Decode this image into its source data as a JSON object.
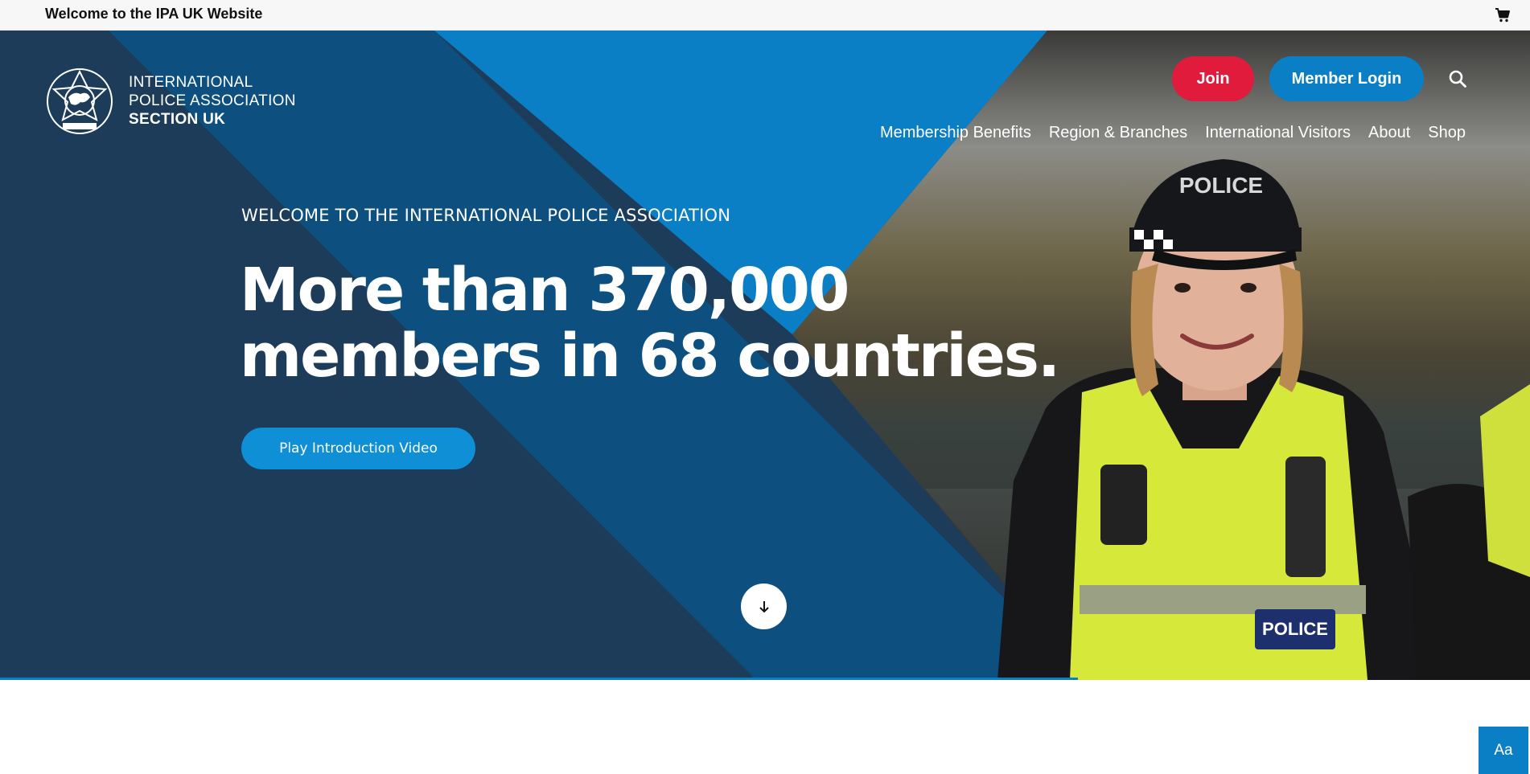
{
  "topbar": {
    "message": "Welcome to the IPA UK Website",
    "cart_icon": "shopping-cart-icon"
  },
  "logo": {
    "line1": "INTERNATIONAL",
    "line2": "POLICE ASSOCIATION",
    "line3": "SECTION UK",
    "emblem_icon": "ipa-globe-emblem"
  },
  "header": {
    "join_label": "Join",
    "login_label": "Member Login",
    "search_icon": "search-icon"
  },
  "nav": {
    "items": [
      {
        "label": "Membership Benefits"
      },
      {
        "label": "Region & Branches"
      },
      {
        "label": "International Visitors"
      },
      {
        "label": "About"
      },
      {
        "label": "Shop"
      }
    ]
  },
  "hero": {
    "kicker": "WELCOME TO THE INTERNATIONAL POLICE ASSOCIATION",
    "headline_line1": "More than 370,000",
    "headline_line2": "members in 68 countries.",
    "video_button": "Play Introduction Video",
    "scroll_icon": "arrow-down-icon",
    "photo_cap_text": "POLICE",
    "photo_badge_text": "POLICE"
  },
  "accessibility": {
    "label": "Aa"
  },
  "colors": {
    "navy": "#1d3c5a",
    "blue": "#0a7fc5",
    "red": "#e01b3c"
  }
}
